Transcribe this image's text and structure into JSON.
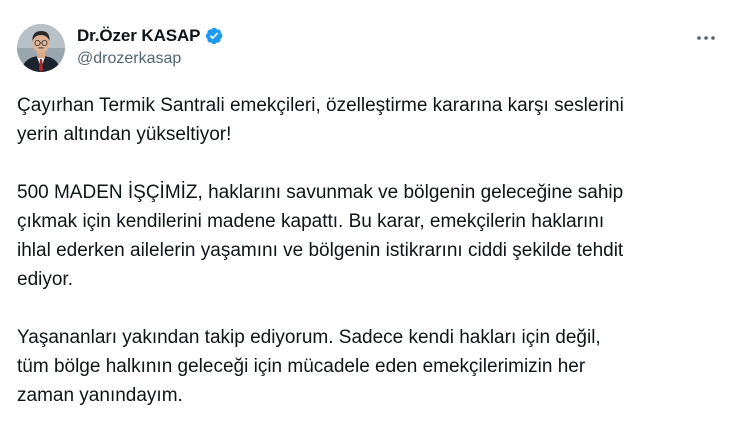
{
  "author": {
    "display_name": "Dr.Özer KASAP",
    "handle": "@drozerkasap",
    "verified": true,
    "verified_color": "#1d9bf0"
  },
  "icons": {
    "verified": "verified-badge-icon",
    "more": "more-options-icon"
  },
  "tweet": {
    "paragraphs": [
      [
        "Çayırhan Termik Santrali emekçileri, özelleştirme kararına karşı seslerini",
        "yerin altından yükseltiyor!"
      ],
      [
        "500 MADEN İŞÇİMİZ, haklarını savunmak ve bölgenin geleceğine sahip",
        "çıkmak için kendilerini madene kapattı. Bu karar, emekçilerin haklarını",
        "ihlal ederken ailelerin yaşamını ve bölgenin istikrarını ciddi şekilde tehdit",
        "ediyor."
      ],
      [
        "Yaşananları yakından takip ediyorum. Sadece kendi hakları için değil,",
        "tüm bölge halkının geleceği için mücadele eden emekçilerimizin her",
        "zaman yanındayım."
      ]
    ]
  },
  "colors": {
    "text": "#0f1419",
    "secondary": "#536471"
  }
}
